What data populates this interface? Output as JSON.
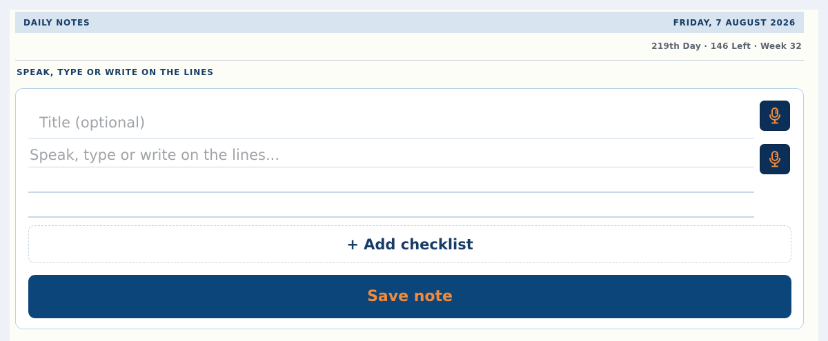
{
  "header": {
    "title": "DAILY NOTES",
    "date": "FRIDAY, 7 AUGUST 2026"
  },
  "day_stats": "219th Day · 146 Left · Week 32",
  "section_label": "SPEAK, TYPE OR WRITE ON THE LINES",
  "form": {
    "title_placeholder": "Title (optional)",
    "title_value": "",
    "body_placeholder": "Speak, type or write on the lines...",
    "body_value": "",
    "mic_icon": "microphone-icon",
    "add_checklist_label": "+ Add checklist",
    "save_label": "Save note"
  },
  "colors": {
    "navy": "#0c457a",
    "mic_bg": "#0c2f57",
    "accent_orange": "#f08a3c",
    "header_bg": "#d9e4f1",
    "label_text": "#173d66"
  }
}
